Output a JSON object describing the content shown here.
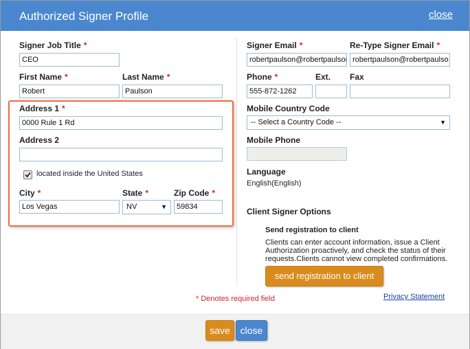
{
  "dialog": {
    "title": "Authorized Signer Profile",
    "close_link": "close"
  },
  "left": {
    "job_title_label": "Signer Job Title",
    "job_title_value": "CEO",
    "first_name_label": "First Name",
    "first_name_value": "Robert",
    "last_name_label": "Last Name",
    "last_name_value": "Paulson",
    "address1_label": "Address 1",
    "address1_value": "0000 Rule 1 Rd",
    "address2_label": "Address 2",
    "address2_value": "",
    "us_checkbox_label": "located inside the United States",
    "us_checkbox_checked": true,
    "city_label": "City",
    "city_value": "Los Vegas",
    "state_label": "State",
    "state_value": "NV",
    "zip_label": "Zip Code",
    "zip_value": "59834"
  },
  "right": {
    "email_label": "Signer Email",
    "email_value": "robertpaulson@robertpaulson",
    "retype_email_label": "Re-Type Signer Email",
    "retype_email_value": "robertpaulson@robertpaulso",
    "phone_label": "Phone",
    "phone_value": "555-872-1262",
    "ext_label": "Ext.",
    "ext_value": "",
    "fax_label": "Fax",
    "fax_value": "",
    "mobile_country_label": "Mobile Country Code",
    "mobile_country_value": "-- Select a Country Code --",
    "mobile_phone_label": "Mobile Phone",
    "mobile_phone_value": "",
    "language_label": "Language",
    "language_value": "English(English)",
    "client_options_heading": "Client Signer Options",
    "send_reg_heading": "Send registration to client",
    "send_reg_desc": "Clients can enter account information, issue a Client Authorization proactively, and check the status of their requests.Clients cannot view completed confirmations.",
    "send_reg_button": "send registration to client",
    "required_note": "* Denotes required field",
    "privacy_link": "Privacy Statement"
  },
  "footer": {
    "save_label": "save",
    "close_label": "close"
  },
  "colors": {
    "title_bar": "#4a87cf",
    "accent_orange": "#d98b1e",
    "required_red": "#d9212a",
    "highlight_border": "#f06a3c"
  },
  "icons": {
    "required": "asterisk",
    "checkbox": "checkmark-icon",
    "dropdown": "caret-down-icon"
  }
}
